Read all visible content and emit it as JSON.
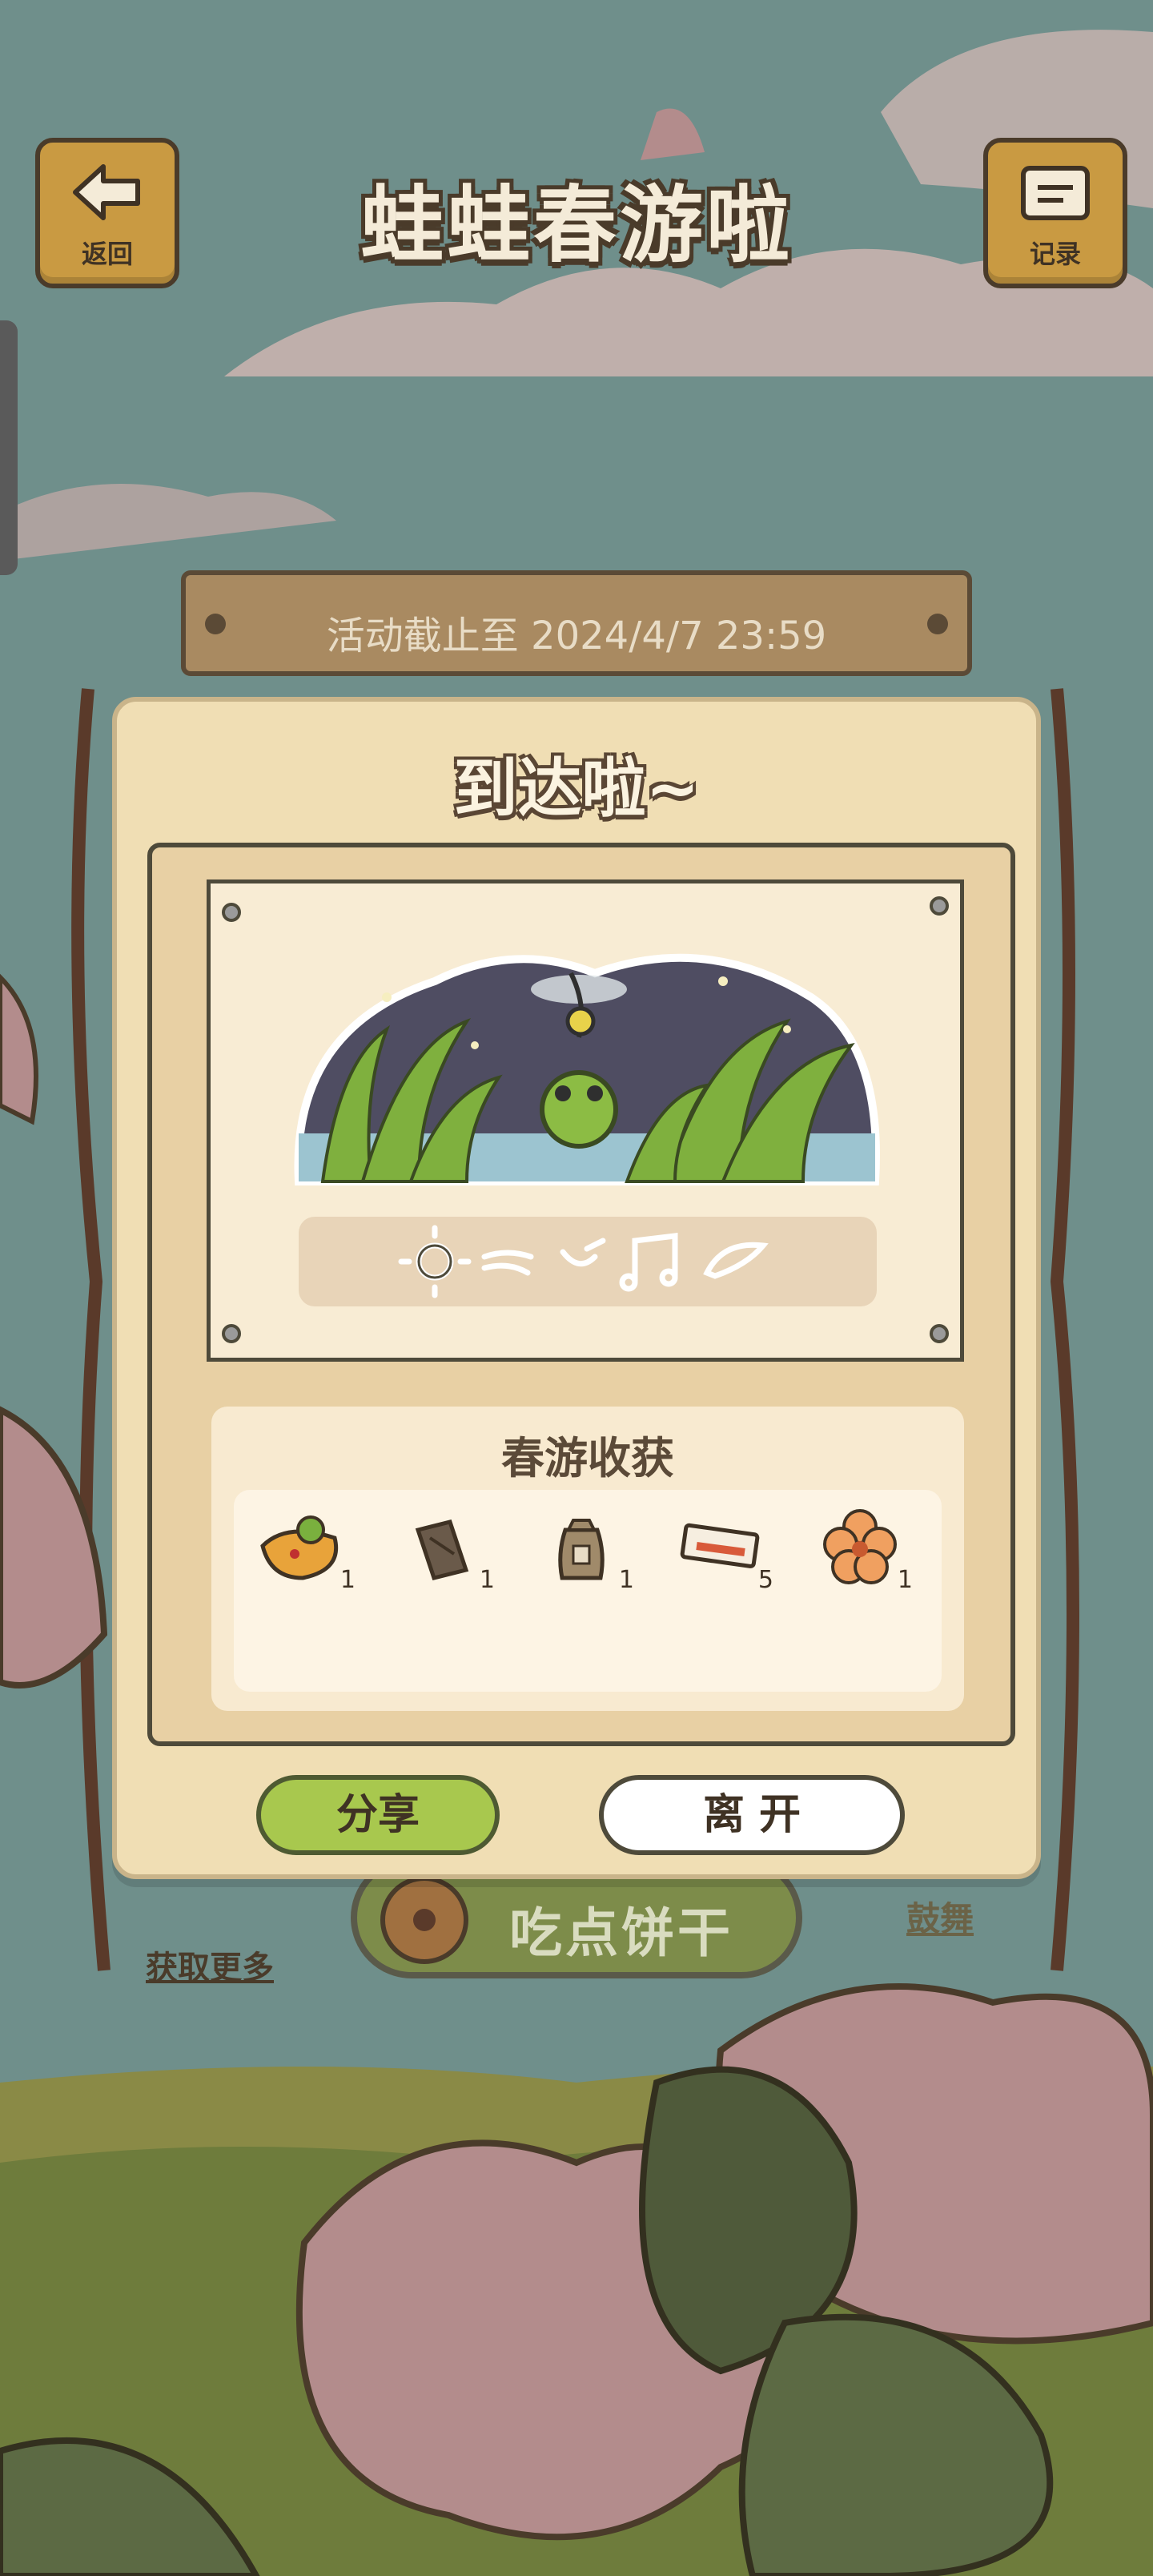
{
  "header": {
    "back_label": "返回",
    "title": "蛙蛙春游啦",
    "record_label": "记录"
  },
  "deadline": "活动截止至 2024/4/7 23:59",
  "board": {
    "cookie_button": "吃点饼干",
    "get_more": "获取更多",
    "drum": "鼓舞"
  },
  "dialog": {
    "title": "到达啦~",
    "loot_title": "春游收获",
    "items": [
      {
        "icon": "omelette-icon",
        "count": "1"
      },
      {
        "icon": "wood-log-icon",
        "count": "1"
      },
      {
        "icon": "seed-bag-icon",
        "count": "1"
      },
      {
        "icon": "ticket-icon",
        "count": "5"
      },
      {
        "icon": "flower-cookie-icon",
        "count": "1"
      }
    ],
    "share_label": "分享",
    "leave_label": "离 开"
  },
  "colors": {
    "accent_green": "#a8c84e",
    "wood": "#c99a42",
    "dialog_bg": "#f0deb4"
  }
}
